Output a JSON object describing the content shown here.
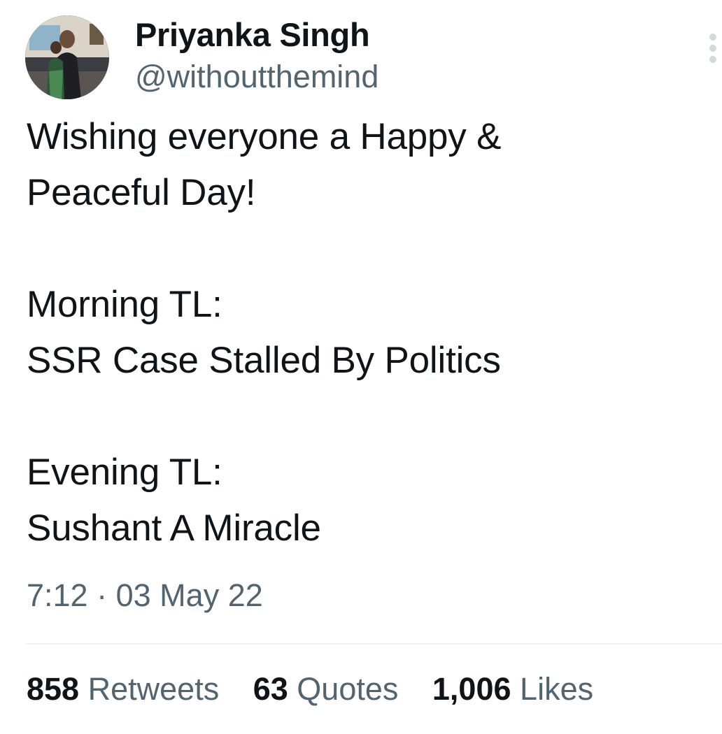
{
  "author": {
    "display_name": "Priyanka Singh",
    "handle": "@withoutthemind",
    "avatar_icon": "profile-photo"
  },
  "tweet": {
    "lines": [
      "Wishing everyone a Happy &",
      "Peaceful Day!",
      "",
      "Morning TL:",
      "SSR Case Stalled By Politics",
      "",
      "Evening TL:",
      "Sushant A Miracle"
    ],
    "time": "7:12",
    "separator": "·",
    "date": "03 May 22"
  },
  "stats": {
    "retweets": {
      "count": "858",
      "label": "Retweets"
    },
    "quotes": {
      "count": "63",
      "label": "Quotes"
    },
    "likes": {
      "count": "1,006",
      "label": "Likes"
    }
  },
  "icons": {
    "more": "more-options-icon"
  },
  "colors": {
    "primary_text": "#0f1419",
    "secondary_text": "#536471",
    "divider": "#eff3f4"
  }
}
